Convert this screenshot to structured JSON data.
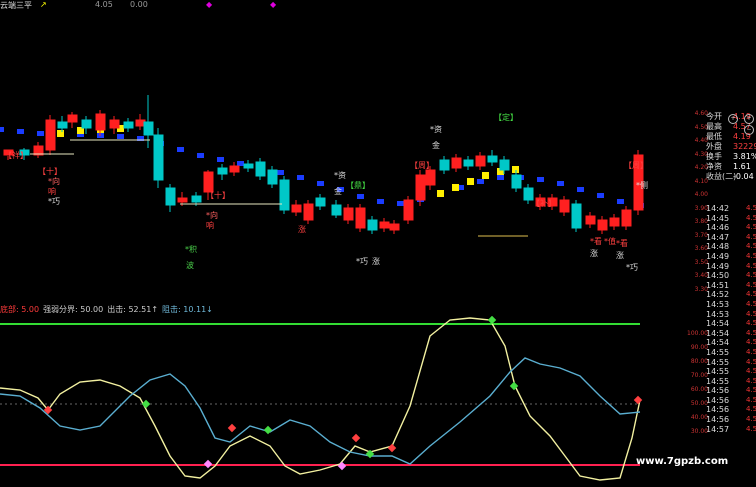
{
  "top_bar": {
    "title": "云端三平",
    "price_a": "4.05",
    "price_b": "0.00"
  },
  "indicator_header": [
    {
      "label": "底部:",
      "value": "5.00",
      "color": "#ff3b3b"
    },
    {
      "label": "强弱分界:",
      "value": "50.00",
      "color": "#cccccc"
    },
    {
      "label": "出击:",
      "value": "52.51↑",
      "color": "#cccccc"
    },
    {
      "label": "阻击:",
      "value": "10.11↓",
      "color": "#6fb8d8"
    }
  ],
  "price_axis": [
    "4.60",
    "4.50",
    "4.40",
    "4.30",
    "4.20",
    "4.10",
    "4.00",
    "3.90",
    "3.80",
    "3.70",
    "3.60",
    "3.50",
    "3.40",
    "3.30"
  ],
  "indicator_axis": [
    "100.00",
    "90.00",
    "80.00",
    "70.00",
    "60.00",
    "50.00",
    "40.00",
    "30.00"
  ],
  "quote_panel": [
    {
      "label": "今开",
      "value": "4.19",
      "color": "#ff4040"
    },
    {
      "label": "最高",
      "value": "4.57",
      "color": "#ff4040"
    },
    {
      "label": "最低",
      "value": "4.19",
      "color": "#ff4040"
    },
    {
      "label": "外盘",
      "value": "32229",
      "color": "#ff4040"
    },
    {
      "label": "换手",
      "value": "3.81%",
      "color": "#ffffff"
    },
    {
      "label": "净资",
      "value": "1.61",
      "color": "#ffffff"
    },
    {
      "label": "收益(二)",
      "value": "-0.04",
      "color": "#ffffff"
    }
  ],
  "time_rows": [
    {
      "time": "14:42",
      "value": "4.5"
    },
    {
      "time": "14:45",
      "value": "4.5"
    },
    {
      "time": "14:46",
      "value": "4.5"
    },
    {
      "time": "14:47",
      "value": "4.5"
    },
    {
      "time": "14:48",
      "value": "4.5"
    },
    {
      "time": "14:49",
      "value": "4.5"
    },
    {
      "time": "14:49",
      "value": "4.5"
    },
    {
      "time": "14:50",
      "value": "4.5"
    },
    {
      "time": "14:51",
      "value": "4.5"
    },
    {
      "time": "14:52",
      "value": "4.5"
    },
    {
      "time": "14:53",
      "value": "4.5"
    },
    {
      "time": "14:53",
      "value": "4.5"
    },
    {
      "time": "14:54",
      "value": "4.5"
    },
    {
      "time": "14:54",
      "value": "4.5"
    },
    {
      "time": "14:54",
      "value": "4.5"
    },
    {
      "time": "14:55",
      "value": "4.5"
    },
    {
      "time": "14:55",
      "value": "4.5"
    },
    {
      "time": "14:55",
      "value": "4.5"
    },
    {
      "time": "14:55",
      "value": "4.5"
    },
    {
      "time": "14:56",
      "value": "4.5"
    },
    {
      "time": "14:56",
      "value": "4.5"
    },
    {
      "time": "14:56",
      "value": "4.5"
    },
    {
      "time": "14:56",
      "value": "4.5"
    },
    {
      "time": "14:57",
      "value": "4.5"
    }
  ],
  "chart_annotations": {
    "shi": "【十】",
    "xiang": "*向",
    "xiang2": "响",
    "qiao": "*巧",
    "zi": "*资",
    "jin": "金",
    "ding": "【鼎】",
    "zhou": "【周】",
    "ding2": "【定】",
    "bu": "【补】",
    "xiang3": "【祥】",
    "zhang": "涨",
    "kan": "*看",
    "ce": "*侧",
    "bo": "波",
    "ji": "*积",
    "zhi": "*值"
  },
  "watermark": "www.7gpzb.com",
  "colors": {
    "up": "#ff2020",
    "down": "#00c8c8",
    "cloud_blue": "#1a3cff",
    "cloud_yellow": "#ffee00",
    "line_yellow": "#f2f0a0",
    "line_cyan": "#5aaed0",
    "green_level": "#33dd33",
    "red_level": "#ff2050"
  }
}
